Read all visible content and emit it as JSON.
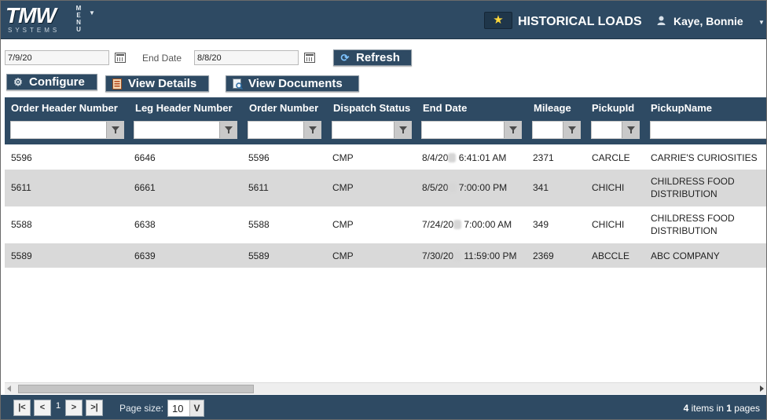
{
  "header": {
    "logo_main": "TMW",
    "logo_sub": "SYSTEMS",
    "menu_label": "MENU",
    "title": "HISTORICAL LOADS",
    "user_name": "Kaye, Bonnie",
    "star_icon": "star-icon",
    "user_icon": "user-icon"
  },
  "toolbar": {
    "start_date": "7/9/20",
    "end_date_label": "End Date",
    "end_date": "8/8/20",
    "refresh_label": "Refresh",
    "configure_label": "Configure",
    "view_details_label": "View Details",
    "view_documents_label": "View Documents"
  },
  "grid": {
    "columns": [
      "Order Header Number",
      "Leg Header Number",
      "Order Number",
      "Dispatch Status",
      "End Date",
      "Mileage",
      "PickupId",
      "PickupName"
    ],
    "rows": [
      {
        "order_header": "5596",
        "leg_header": "6646",
        "order_number": "5596",
        "status": "CMP",
        "end_date_a": "8/4/20",
        "end_date_b": "6:41:01 AM",
        "mileage": "2371",
        "pickup_id": "CARCLE",
        "pickup_name_1": "CARRIE'S CURIOSITIES",
        "pickup_name_2": ""
      },
      {
        "order_header": "5611",
        "leg_header": "6661",
        "order_number": "5611",
        "status": "CMP",
        "end_date_a": "8/5/20",
        "end_date_b": "7:00:00 PM",
        "mileage": "341",
        "pickup_id": "CHICHI",
        "pickup_name_1": "CHILDRESS FOOD",
        "pickup_name_2": "DISTRIBUTION"
      },
      {
        "order_header": "5588",
        "leg_header": "6638",
        "order_number": "5588",
        "status": "CMP",
        "end_date_a": "7/24/20",
        "end_date_b": "7:00:00 AM",
        "mileage": "349",
        "pickup_id": "CHICHI",
        "pickup_name_1": "CHILDRESS FOOD",
        "pickup_name_2": "DISTRIBUTION"
      },
      {
        "order_header": "5589",
        "leg_header": "6639",
        "order_number": "5589",
        "status": "CMP",
        "end_date_a": "7/30/20",
        "end_date_b": "11:59:00 PM",
        "mileage": "2369",
        "pickup_id": "ABCCLE",
        "pickup_name_1": "ABC COMPANY",
        "pickup_name_2": ""
      }
    ]
  },
  "pager": {
    "first": "|<",
    "prev": "<",
    "current_page": "1",
    "next": ">",
    "last": ">|",
    "page_size_label": "Page size:",
    "page_size": "10",
    "dropdown_glyph": "V",
    "items_count": "4",
    "items_text_a": " items in ",
    "pages_count": "1",
    "items_text_b": " pages"
  }
}
